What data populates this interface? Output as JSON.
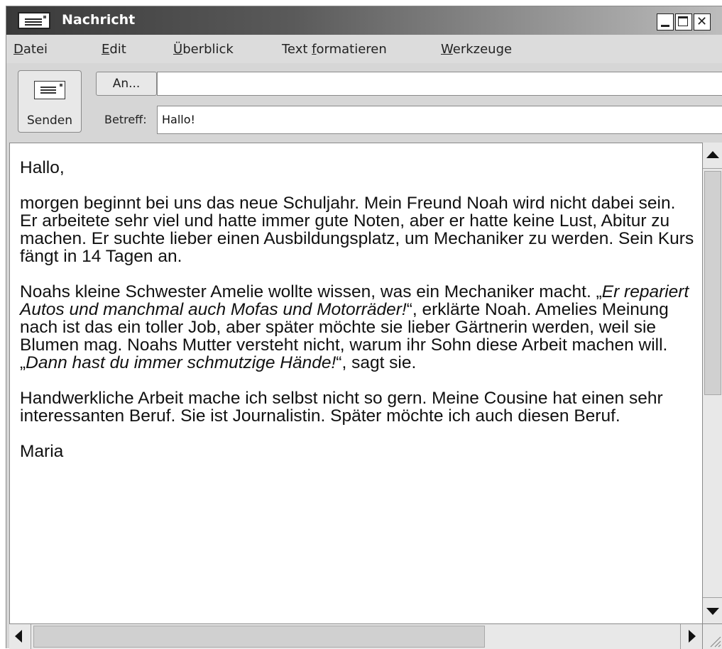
{
  "window": {
    "title": "Nachricht",
    "close_glyph": "✕"
  },
  "menu": [
    {
      "pre": "",
      "u": "D",
      "post": "atei"
    },
    {
      "pre": "",
      "u": "E",
      "post": "dit"
    },
    {
      "pre": "",
      "u": "Ü",
      "post": "berblick"
    },
    {
      "pre": "Text ",
      "u": "f",
      "post": "ormatieren"
    },
    {
      "pre": "",
      "u": "W",
      "post": "erkzeuge"
    }
  ],
  "toolbar": {
    "send_label": "Senden",
    "to_button": "An...",
    "to_value": "",
    "subject_label": "Betreff:",
    "subject_value": "Hallo!"
  },
  "message": {
    "greeting": "Hallo,",
    "p1": "morgen beginnt bei uns das neue Schuljahr. Mein Freund Noah wird nicht dabei sein. Er arbeitete sehr viel und hatte immer gute Noten, aber er hatte keine Lust, Abitur zu machen. Er suchte lieber einen Ausbildungsplatz, um Mechaniker zu werden. Sein Kurs fängt in 14 Tagen an.",
    "p2_a": "Noahs kleine Schwester Amelie wollte wissen, was ein Mechaniker macht. „",
    "p2_b": "Er repariert Autos und manchmal auch Mofas und Motorräder!",
    "p2_c": "“, erklärte Noah. Amelies Meinung nach ist das ein toller Job, aber später möchte sie lieber Gärtnerin werden, weil sie Blumen mag. Noahs Mutter versteht nicht, warum ihr Sohn diese Arbeit machen will. „",
    "p2_d": "Dann hast du immer schmutzige Hände!",
    "p2_e": "“, sagt sie.",
    "p3": "Handwerkliche Arbeit mache ich selbst nicht so gern. Meine Cousine hat einen sehr interessanten Beruf. Sie ist Journalistin. Später möchte ich auch diesen Beruf.",
    "signature": "Maria"
  },
  "icons": {
    "app": "envelope-icon",
    "send": "envelope-icon",
    "scroll_up": "triangle-up-icon",
    "scroll_down": "triangle-down-icon",
    "scroll_left": "triangle-left-icon",
    "scroll_right": "triangle-right-icon",
    "resize": "resize-grip-icon"
  }
}
